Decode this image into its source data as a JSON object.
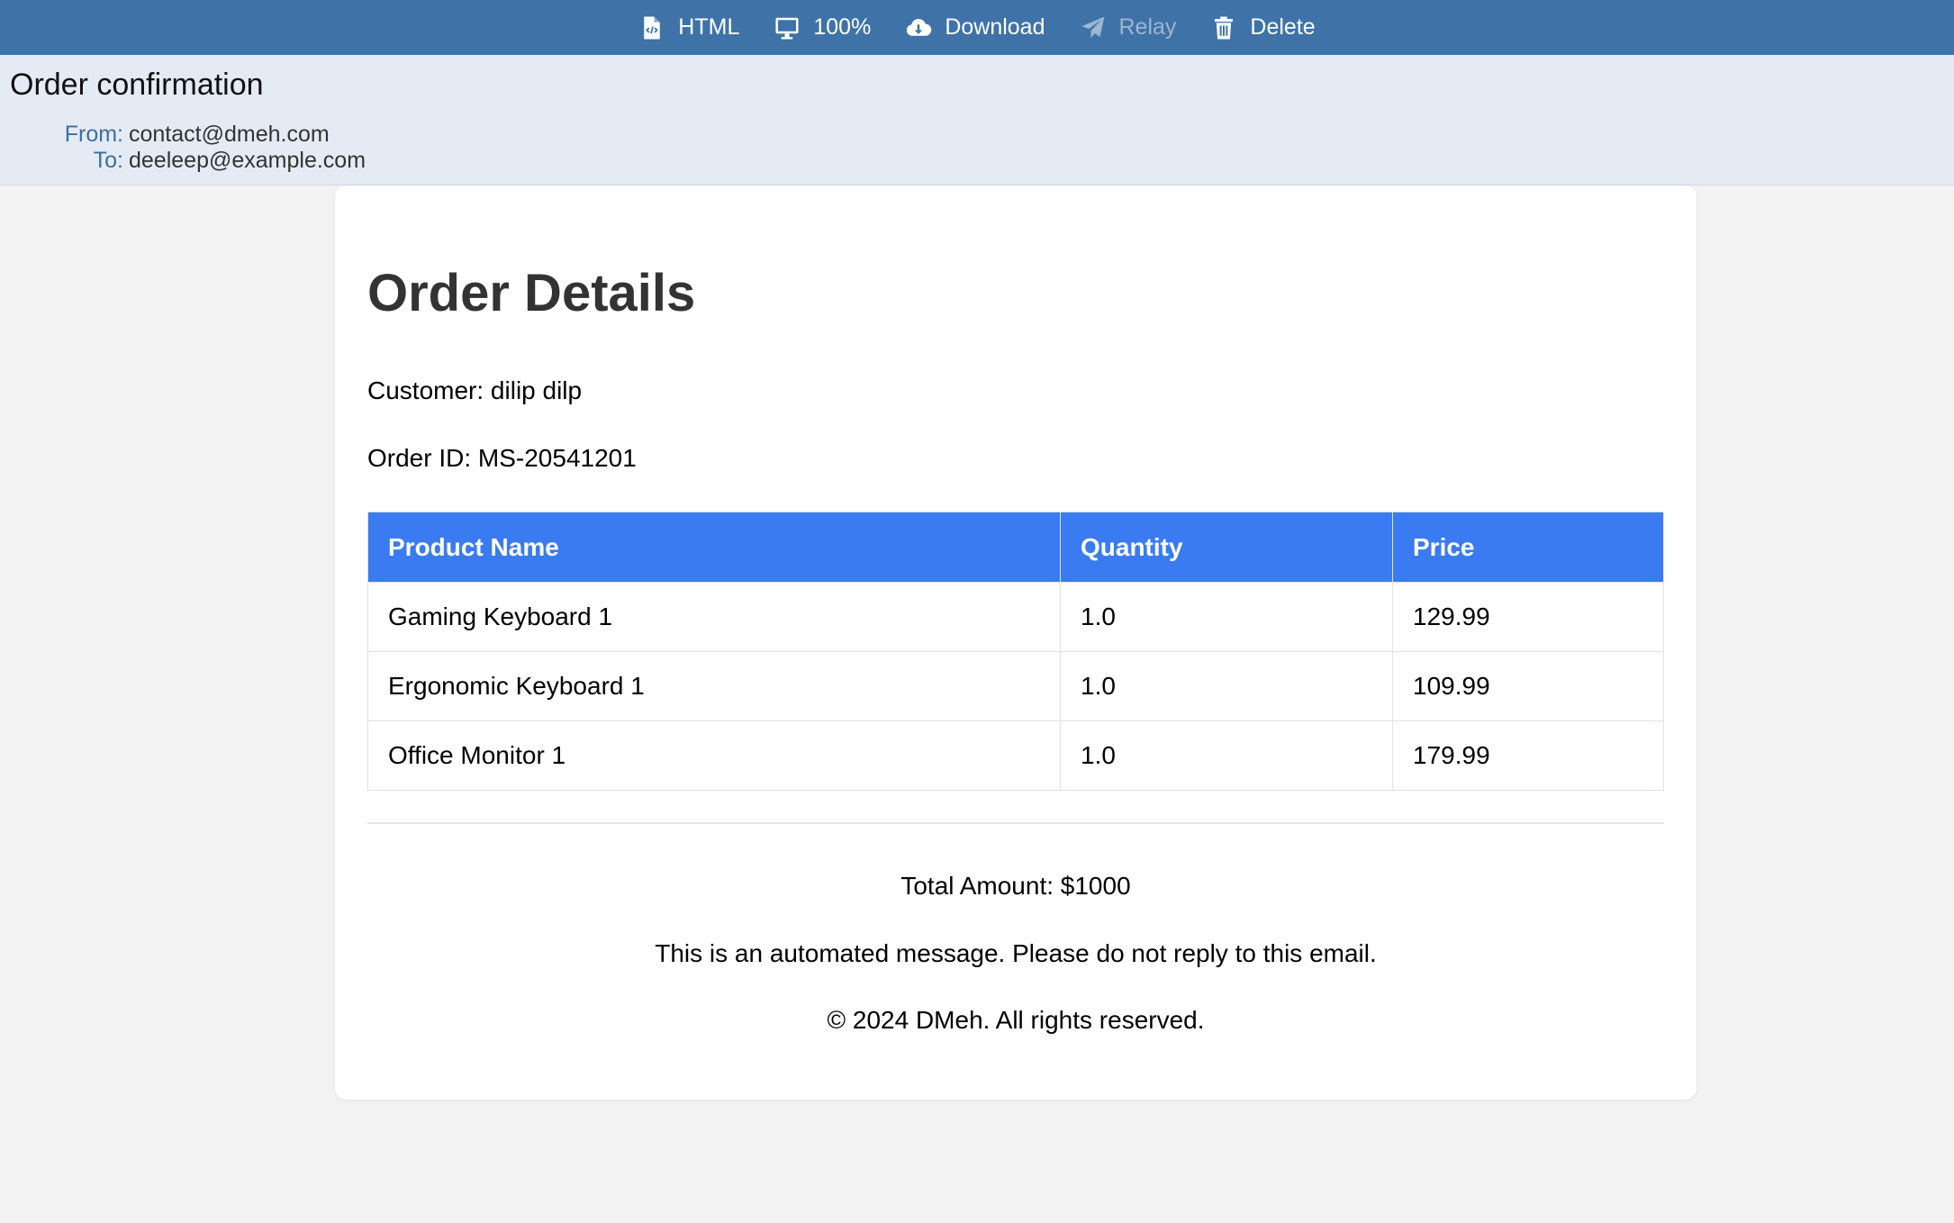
{
  "toolbar": {
    "items": [
      {
        "label": "HTML",
        "icon": "html-file-icon",
        "enabled": true
      },
      {
        "label": "100%",
        "icon": "monitor-icon",
        "enabled": true
      },
      {
        "label": "Download",
        "icon": "cloud-download-icon",
        "enabled": true
      },
      {
        "label": "Relay",
        "icon": "paper-plane-icon",
        "enabled": false
      },
      {
        "label": "Delete",
        "icon": "trash-icon",
        "enabled": true
      }
    ],
    "bg_color": "#3f73a8"
  },
  "header": {
    "subject": "Order confirmation",
    "from_label": "From:",
    "from_value": "contact@dmeh.com",
    "to_label": "To:",
    "to_value": "deeleep@example.com"
  },
  "email": {
    "title": "Order Details",
    "customer": "Customer: dilip dilp",
    "order_id": "Order ID: MS-20541201",
    "table": {
      "headers": [
        "Product Name",
        "Quantity",
        "Price"
      ],
      "rows": [
        [
          "Gaming Keyboard 1",
          "1.0",
          "129.99"
        ],
        [
          "Ergonomic Keyboard 1",
          "1.0",
          "109.99"
        ],
        [
          "Office Monitor 1",
          "1.0",
          "179.99"
        ]
      ],
      "header_color": "#3a7bf2"
    },
    "total": "Total Amount: $1000",
    "automated_note": "This is an automated message. Please do not reply to this email.",
    "copyright": "© 2024 DMeh. All rights reserved."
  }
}
